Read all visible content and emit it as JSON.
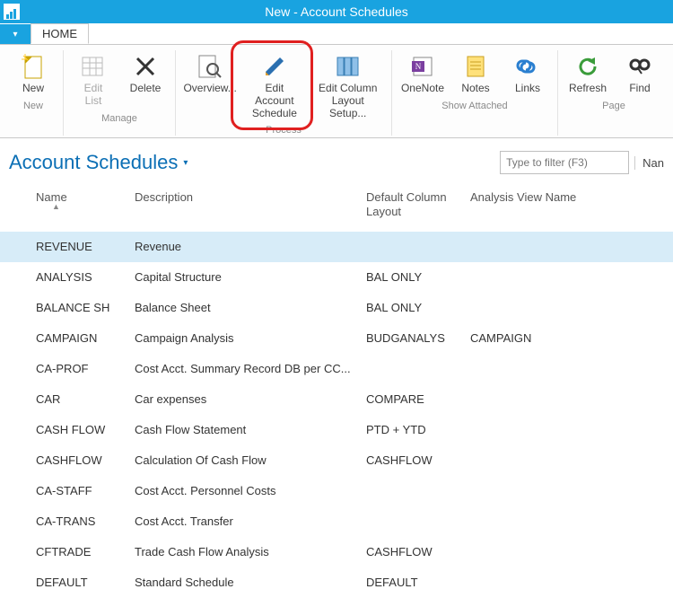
{
  "window": {
    "title": "New - Account Schedules"
  },
  "tabs": {
    "home": "HOME"
  },
  "ribbon": {
    "groups": {
      "new": {
        "label": "New",
        "new_btn": "New"
      },
      "manage": {
        "label": "Manage",
        "edit_list": "Edit\nList",
        "delete_btn": "Delete"
      },
      "process": {
        "label": "Process",
        "overview": "Overview...",
        "edit_acct": "Edit Account\nSchedule",
        "edit_col": "Edit Column\nLayout Setup..."
      },
      "show_attached": {
        "label": "Show Attached",
        "onenote": "OneNote",
        "notes": "Notes",
        "links": "Links"
      },
      "page": {
        "label": "Page",
        "refresh": "Refresh",
        "find": "Find"
      }
    }
  },
  "page": {
    "title": "Account Schedules",
    "filter_placeholder": "Type to filter (F3)",
    "filter_column": "Nan"
  },
  "grid": {
    "headers": {
      "name": "Name",
      "desc": "Description",
      "layout": "Default Column Layout",
      "view": "Analysis View Name"
    },
    "rows": [
      {
        "name": "REVENUE",
        "desc": "Revenue",
        "layout": "",
        "view": "",
        "selected": true
      },
      {
        "name": "ANALYSIS",
        "desc": "Capital Structure",
        "layout": "BAL ONLY",
        "view": ""
      },
      {
        "name": "BALANCE SH",
        "desc": "Balance Sheet",
        "layout": "BAL ONLY",
        "view": ""
      },
      {
        "name": "CAMPAIGN",
        "desc": "Campaign Analysis",
        "layout": "BUDGANALYS",
        "view": "CAMPAIGN"
      },
      {
        "name": "CA-PROF",
        "desc": "Cost Acct. Summary Record DB per CC...",
        "layout": "",
        "view": ""
      },
      {
        "name": "CAR",
        "desc": "Car expenses",
        "layout": "COMPARE",
        "view": ""
      },
      {
        "name": "CASH FLOW",
        "desc": "Cash Flow Statement",
        "layout": "PTD + YTD",
        "view": ""
      },
      {
        "name": "CASHFLOW",
        "desc": "Calculation Of Cash Flow",
        "layout": "CASHFLOW",
        "view": ""
      },
      {
        "name": "CA-STAFF",
        "desc": "Cost Acct. Personnel Costs",
        "layout": "",
        "view": ""
      },
      {
        "name": "CA-TRANS",
        "desc": "Cost Acct. Transfer",
        "layout": "",
        "view": ""
      },
      {
        "name": "CFTRADE",
        "desc": "Trade Cash Flow Analysis",
        "layout": "CASHFLOW",
        "view": ""
      },
      {
        "name": "DEFAULT",
        "desc": "Standard Schedule",
        "layout": "DEFAULT",
        "view": ""
      }
    ]
  }
}
